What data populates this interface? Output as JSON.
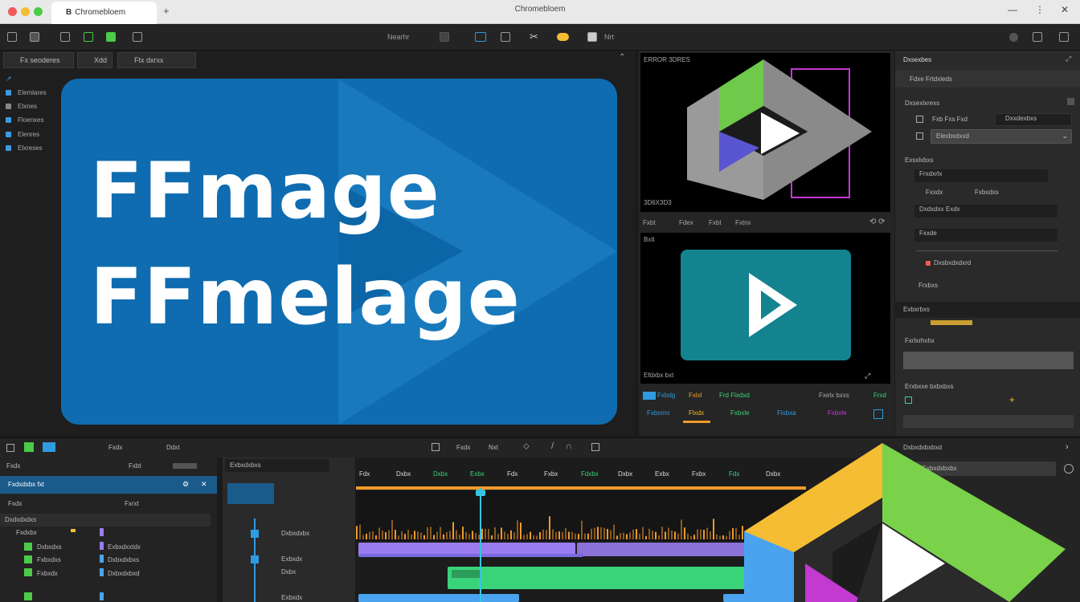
{
  "window": {
    "tab_title": "Chromebloem",
    "title": "Chromebloem",
    "plus": "+",
    "close": "✕",
    "minimize": "—",
    "maximize": "⋮"
  },
  "toolbar": {
    "label_center": "Nearhr",
    "label_right": "Nrt",
    "accent": "#2f9be0"
  },
  "left_panel": {
    "tabs": [
      "Fx seoderes",
      "Xdd",
      "Ftx dxrxx"
    ],
    "items": [
      "Elemlares",
      "Elxnes",
      "Floenxes",
      "Elenres",
      "Elxreses"
    ],
    "item_colors": [
      "#3a9be0",
      "#888888",
      "#888888",
      "#3a9be0",
      "#3a9be0"
    ]
  },
  "canvas": {
    "line1": "FFmage",
    "line2": "FFmelage",
    "bg": "#0f6cb0"
  },
  "previews": {
    "top_label": "ERROR 3DRES",
    "top_bottom_left": "3D6X3D3",
    "strip": [
      "Fxbt",
      "Fdex",
      "Fxbt",
      "Fxtnx"
    ],
    "bottom_label": "Bxtl",
    "bottom_bottom_left": "Efdxbx bxt",
    "controls_row1": [
      "Fxbdg",
      "Fxlxl",
      "Frd Flxdxd",
      "Fxelx bxxs",
      "Frxd"
    ],
    "controls_row2": [
      "Fxbxrnx",
      "Flxdx",
      "Fxbxle",
      "Flxbxa",
      "Fxbxle"
    ]
  },
  "inspector": {
    "title": "Dxsexbes",
    "sections": [
      "Fdxe Frtdxleds",
      "Dxsexlxrexs",
      "Fxb Fxs Fxd",
      "Dxxdexbxs",
      "Exsxlxbxs",
      "Frxdxrlx",
      "Fxxdx",
      "Fxbxdxs",
      "Dxdxdxx Exdx",
      "Fxxde",
      "Dxsbxdxdxrd",
      "Frxbxs",
      "Exbxrbxs",
      "Fxrlxrhxhx",
      "Erxbxxe bxbxbxs"
    ],
    "select_value": "Elexbxdxxd"
  },
  "timeline": {
    "header_left": [
      "Fxdx",
      "Ddxt"
    ],
    "header_center": [
      "Fxdx",
      "Nxt"
    ],
    "left_rows": [
      {
        "label": "Fxdx",
        "sub": "Fxbt"
      },
      {
        "label": "Fxdxdxbx fxt",
        "sub": ""
      },
      {
        "label": "Fxdx",
        "sub": "Fxrxt"
      },
      {
        "label": "Dxdxdxdxs",
        "sub": ""
      },
      {
        "label": "Fxdxbx",
        "sub": "Dxbxxdxs"
      },
      {
        "label": "Dxbxdxs",
        "sub": "Exbxdxxtdx"
      },
      {
        "label": "Fxbxdxs",
        "sub": "Dxbxdxbxs"
      },
      {
        "label": "Fxbxdx",
        "sub": "Dxbxdxbxd"
      }
    ],
    "mid_title": "Exbxdxbxs",
    "mid_rows": [
      "Dxbxdxbx",
      "Exbxdx",
      "Dxbx",
      "Exbxdx"
    ],
    "ruler": [
      "Fdx",
      "Dxbx",
      "Dxbx",
      "Exbx",
      "Fdx",
      "Fxbx",
      "Fdxbx",
      "Dxbx",
      "Exbx",
      "Fxbx",
      "Fdx",
      "Dxbx"
    ],
    "right_panel_title": "Dxbxdxbxbxd",
    "right_select": "Fxbxdxbxbx",
    "playhead_color": "#36c4e0",
    "colors": {
      "orange": "#f19a2a",
      "purple": "#9b7cf0",
      "green": "#39d47a",
      "blue": "#4aa3ef"
    }
  }
}
